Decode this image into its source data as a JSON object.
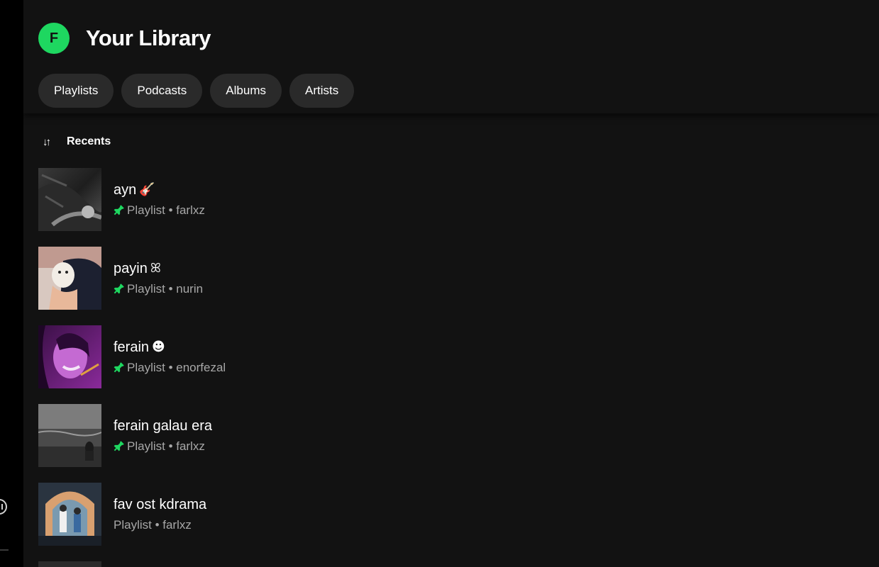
{
  "header": {
    "avatar_letter": "F",
    "title": "Your Library"
  },
  "filters": [
    {
      "label": "Playlists"
    },
    {
      "label": "Podcasts"
    },
    {
      "label": "Albums"
    },
    {
      "label": "Artists"
    }
  ],
  "sort": {
    "icon": "sort-arrows-icon",
    "label": "Recents"
  },
  "items": [
    {
      "title": "ayn",
      "emoji": "🎸",
      "type": "Playlist",
      "owner": "farlxz",
      "pinned": true,
      "sub": "Playlist • farlxz"
    },
    {
      "title": "payin",
      "emoji": "ꕤ",
      "type": "Playlist",
      "owner": "nurin",
      "pinned": true,
      "sub": "Playlist • nurin"
    },
    {
      "title": "ferain",
      "emoji": "☻",
      "type": "Playlist",
      "owner": "enorfezal",
      "pinned": true,
      "sub": "Playlist • enorfezal"
    },
    {
      "title": "ferain galau era",
      "emoji": "",
      "type": "Playlist",
      "owner": "farlxz",
      "pinned": true,
      "sub": "Playlist • farlxz"
    },
    {
      "title": "fav ost kdrama",
      "emoji": "",
      "type": "Playlist",
      "owner": "farlxz",
      "pinned": false,
      "sub": "Playlist • farlxz"
    }
  ],
  "colors": {
    "accent": "#1ed760",
    "background": "#121212",
    "chip": "#2a2a2a",
    "subtext": "#a7a7a7"
  }
}
